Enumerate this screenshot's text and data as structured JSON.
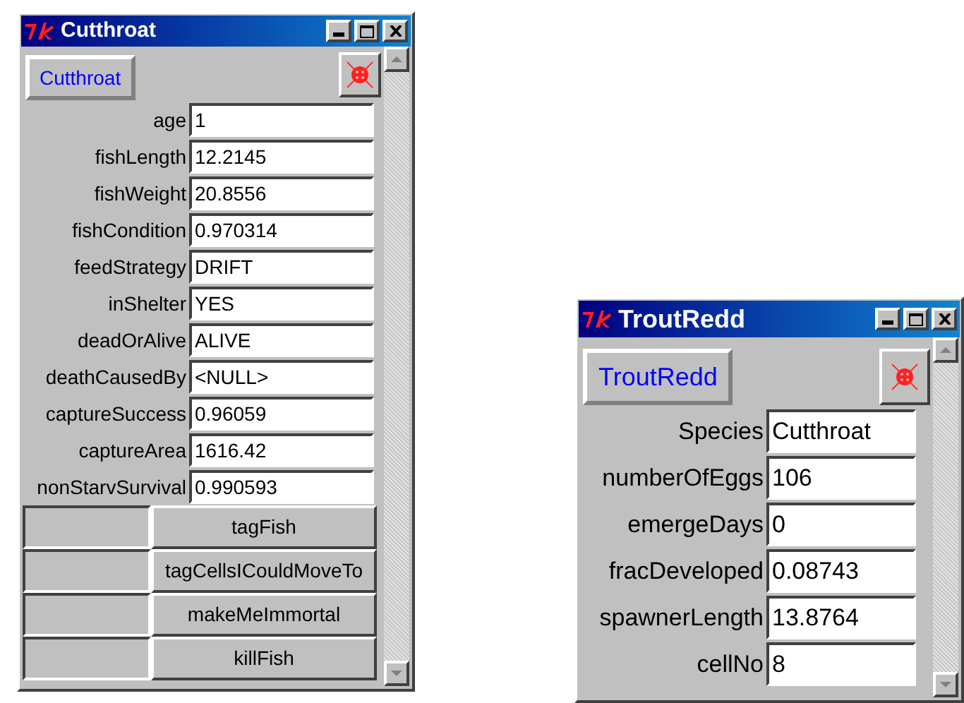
{
  "windows": [
    {
      "title": "Cutthroat",
      "object_button": "Cutthroat",
      "fields": [
        {
          "label": "age",
          "value": "1"
        },
        {
          "label": "fishLength",
          "value": "12.2145"
        },
        {
          "label": "fishWeight",
          "value": "20.8556"
        },
        {
          "label": "fishCondition",
          "value": "0.970314"
        },
        {
          "label": "feedStrategy",
          "value": "DRIFT"
        },
        {
          "label": "inShelter",
          "value": "YES"
        },
        {
          "label": "deadOrAlive",
          "value": "ALIVE"
        },
        {
          "label": "deathCausedBy",
          "value": "<NULL>"
        },
        {
          "label": "captureSuccess",
          "value": "0.96059"
        },
        {
          "label": "captureArea",
          "value": "1616.42"
        },
        {
          "label": "nonStarvSurvival",
          "value": "0.990593"
        }
      ],
      "actions": [
        "tagFish",
        "tagCellsICouldMoveTo",
        "makeMeImmortal",
        "killFish"
      ]
    },
    {
      "title": "TroutRedd",
      "object_button": "TroutRedd",
      "fields": [
        {
          "label": "Species",
          "value": "Cutthroat"
        },
        {
          "label": "numberOfEggs",
          "value": "106"
        },
        {
          "label": "emergeDays",
          "value": "0"
        },
        {
          "label": "fracDeveloped",
          "value": "0.08743"
        },
        {
          "label": "spawnerLength",
          "value": "13.8764"
        },
        {
          "label": "cellNo",
          "value": "8"
        }
      ]
    }
  ]
}
